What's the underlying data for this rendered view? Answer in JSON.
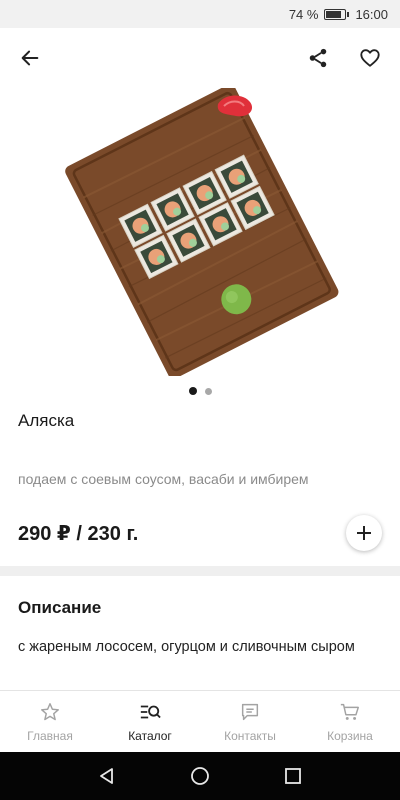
{
  "status_bar": {
    "battery_percent": "74 %",
    "time": "16:00",
    "battery_level": 0.74
  },
  "app_bar": {
    "back_icon": "arrow-left-icon",
    "share_icon": "share-icon",
    "favorite_icon": "heart-outline-icon"
  },
  "product": {
    "name": "Аляска",
    "serving_note": "подаем с соевым соусом, васаби и имбирем",
    "price": "290 ₽ / 230 г.",
    "add_label": "+",
    "gallery": {
      "total_images": 2,
      "current_index": 1
    }
  },
  "description": {
    "title": "Описание",
    "text": "с жареным лососем, огурцом и сливочным сыром"
  },
  "bottom_nav": {
    "items": [
      {
        "label": "Главная",
        "icon": "star-icon",
        "active": false
      },
      {
        "label": "Каталог",
        "icon": "catalog-search-icon",
        "active": true
      },
      {
        "label": "Контакты",
        "icon": "chat-icon",
        "active": false
      },
      {
        "label": "Корзина",
        "icon": "cart-icon",
        "active": false
      }
    ]
  },
  "system_nav": {
    "icons": [
      "back-triangle-icon",
      "home-circle-icon",
      "recents-square-icon"
    ]
  }
}
